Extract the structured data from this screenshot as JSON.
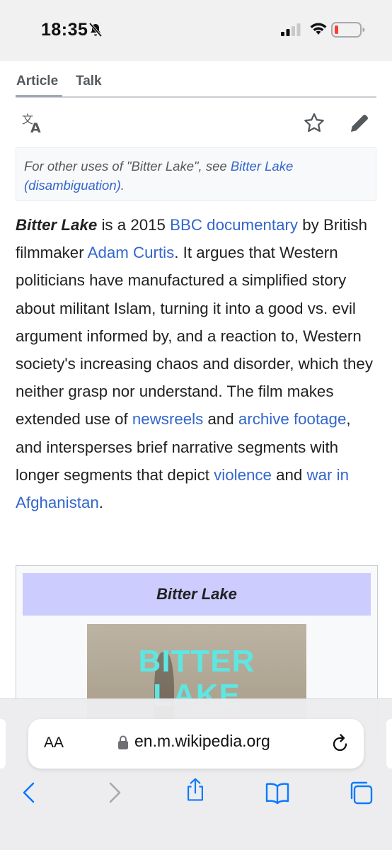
{
  "status": {
    "time": "18:35"
  },
  "tabs": [
    {
      "label": "Article"
    },
    {
      "label": "Talk"
    }
  ],
  "hatnote": {
    "prefix": "For other uses of \"Bitter Lake\", see ",
    "link": "Bitter Lake (disambiguation)",
    "suffix": "."
  },
  "lead": {
    "bold_title": "Bitter Lake",
    "t1": " is a 2015 ",
    "l1": "BBC documentary",
    "t2": " by British filmmaker ",
    "l2": "Adam Curtis",
    "t3": ". It argues that Western politicians have manufactured a simplified story about militant Islam, turning it into a good vs. evil argument informed by, and a reaction to, Western society's increasing chaos and disorder, which they neither grasp nor understand. The film makes extended use of ",
    "l3": "newsreels",
    "t4": " and ",
    "l4": "archive footage",
    "t5": ", and intersperses brief narrative segments with longer segments that depict ",
    "l5": "violence",
    "t6": " and ",
    "l6": "war in Afghanistan",
    "t7": "."
  },
  "infobox": {
    "title": "Bitter Lake",
    "poster_line1": "BITTER",
    "poster_line2": "LAKE"
  },
  "browser": {
    "text_size_label": "AA",
    "url": "en.m.wikipedia.org"
  },
  "colors": {
    "link": "#3366cc",
    "infobox_header": "#ccccff",
    "accent_ios": "#0a7aff"
  }
}
